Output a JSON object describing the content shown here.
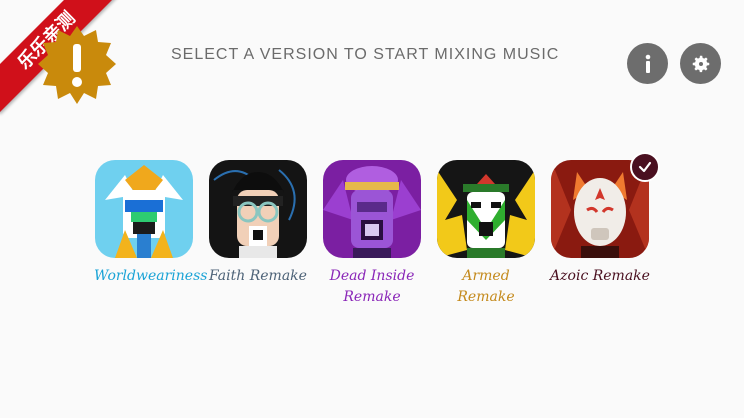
{
  "badge": {
    "text": "乐乐亲测"
  },
  "header": {
    "title": "SELECT A VERSION TO START MIXING MUSIC"
  },
  "versions": [
    {
      "label": "Worldweariness",
      "color": "#1aa3d6"
    },
    {
      "label": "Faith Remake",
      "color": "#4e6378"
    },
    {
      "label": "Dead Inside Remake",
      "color": "#8a26b8"
    },
    {
      "label": "Armed Remake",
      "color": "#c48a1c"
    },
    {
      "label": "Azoic Remake",
      "color": "#4a1020"
    }
  ]
}
